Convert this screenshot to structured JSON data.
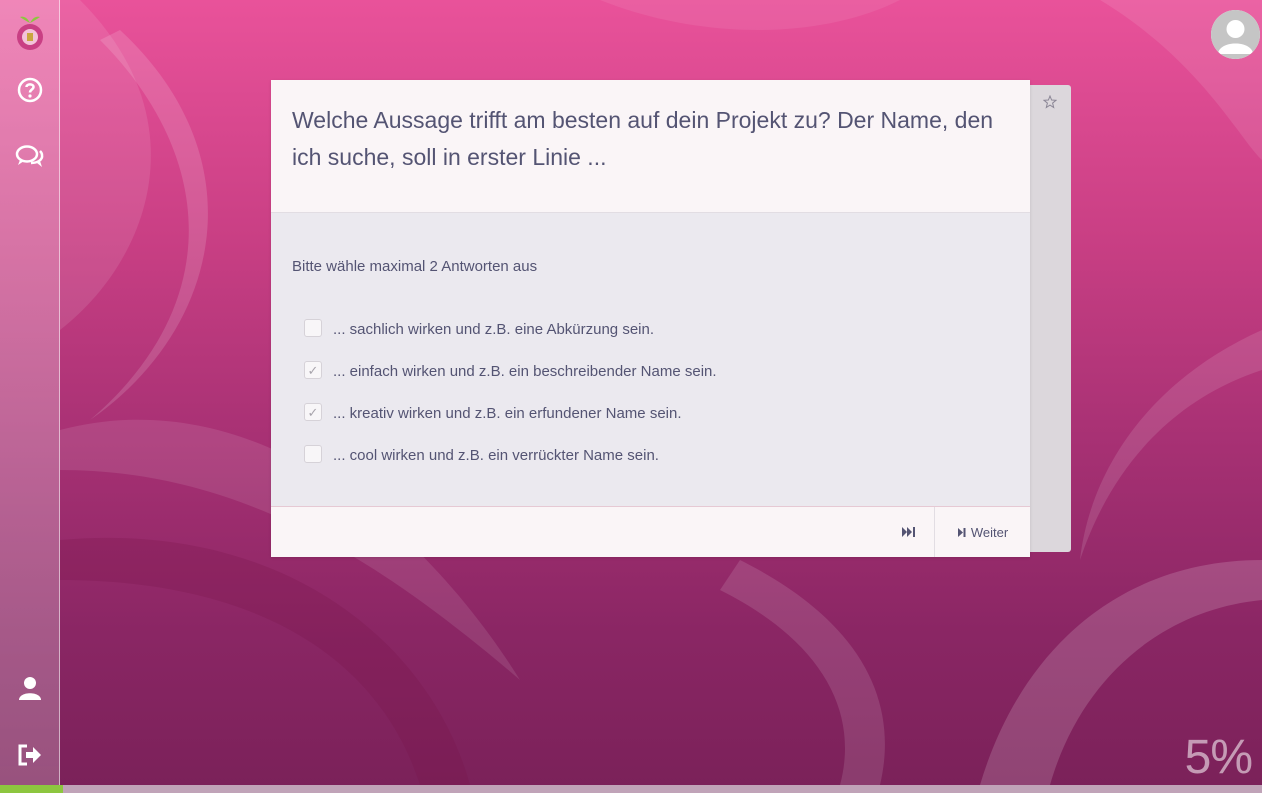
{
  "sidebar": {
    "icons": [
      "logo-icon",
      "help-icon",
      "chat-icon",
      "user-icon",
      "logout-icon"
    ]
  },
  "question": {
    "text": "Welche Aussage trifft am besten auf dein Projekt zu? Der Name, den ich suche, soll in erster Linie ..."
  },
  "instruction": "Bitte wähle maximal 2 Antworten aus",
  "options": [
    {
      "label": "... sachlich wirken und z.B. eine Abkürzung sein.",
      "checked": false
    },
    {
      "label": "... einfach wirken und z.B. ein beschreibender Name sein.",
      "checked": true
    },
    {
      "label": "... kreativ wirken und z.B. ein erfundener Name sein.",
      "checked": true
    },
    {
      "label": "... cool wirken und z.B. ein verrückter Name sein.",
      "checked": false
    }
  ],
  "footer": {
    "next_label": "Weiter"
  },
  "progress": {
    "percent_label": "5%",
    "fraction": 0.05
  },
  "colors": {
    "accent": "#e9529a",
    "progress": "#8dc63f",
    "text": "#545473"
  }
}
